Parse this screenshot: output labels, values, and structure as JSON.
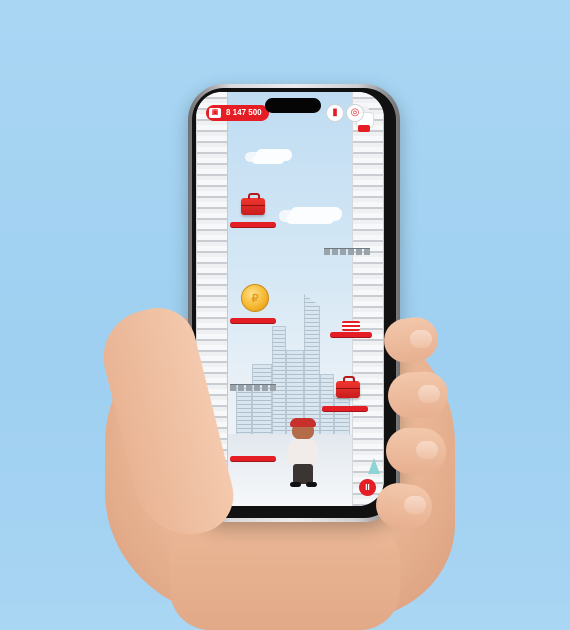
{
  "hud": {
    "score": "8 147 500",
    "wallet_icon": "wallet-icon",
    "left_badge_icon": "cup-icon",
    "right_badge_icon": "target-icon",
    "pause_icon": "pause-icon",
    "pause_glyph": "II"
  },
  "items": {
    "coin_glyph": "₽"
  },
  "colors": {
    "accent": "#e51e25",
    "background": "#a9d6f3"
  }
}
